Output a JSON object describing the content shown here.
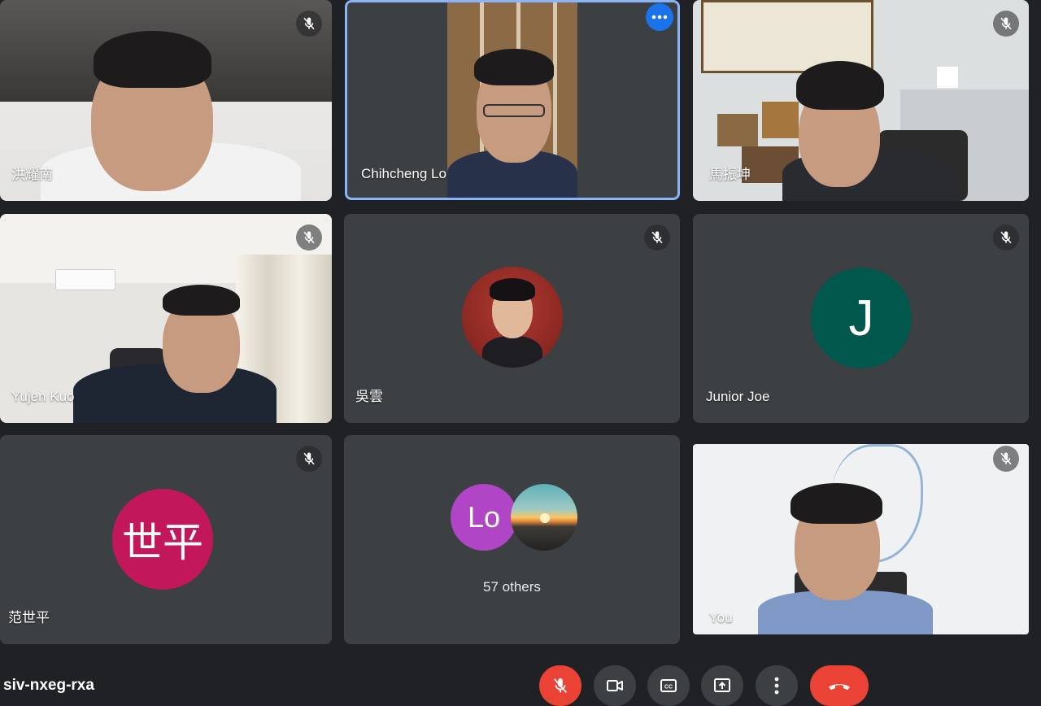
{
  "meeting": {
    "code": "siv-nxeg-rxa"
  },
  "participants": {
    "p1": {
      "name": "洪耀南"
    },
    "p2": {
      "name": "Chihcheng Lo"
    },
    "p3": {
      "name": "馬振坤"
    },
    "p4": {
      "name": "Yujen Kuo"
    },
    "p5": {
      "name": "吳雲"
    },
    "p6": {
      "name": "Junior Joe",
      "initial": "J",
      "avatar_color": "#00574b"
    },
    "p7": {
      "name": "范世平",
      "initial": "世平",
      "avatar_color": "#c2185b"
    },
    "others": {
      "label": "57 others",
      "avatar_initial": "Lo",
      "avatar_color": "#b045c6"
    },
    "self": {
      "name": "You"
    }
  },
  "controls": {
    "mic": "mic-off-icon",
    "camera": "videocam-icon",
    "captions": "closed-captions-icon",
    "present": "present-screen-icon",
    "more": "more-vert-icon",
    "leave": "call-end-icon"
  },
  "colors": {
    "accent": "#1a73e8",
    "speaking": "#8ab4f8",
    "danger": "#ea4335"
  }
}
